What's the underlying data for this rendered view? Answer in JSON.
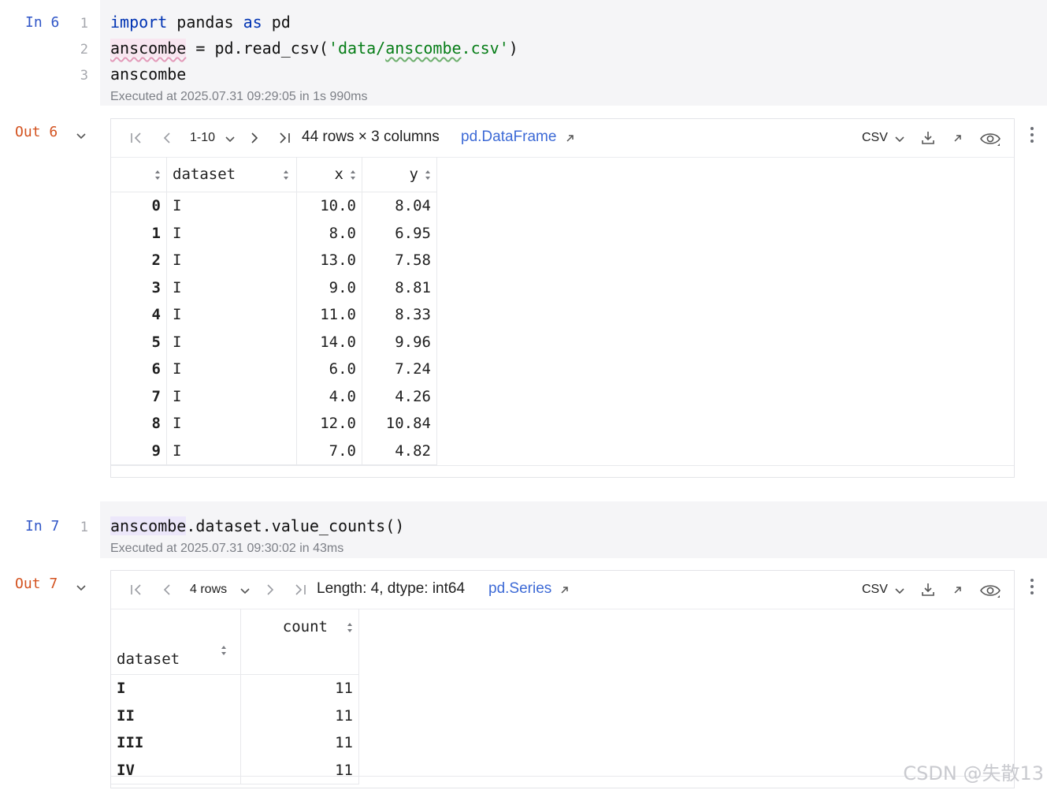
{
  "cell1": {
    "prompt_in": "In 6",
    "line_numbers": [
      "1",
      "2",
      "3"
    ],
    "code": {
      "l1_kw1": "import",
      "l1_mid": " pandas ",
      "l1_kw2": "as",
      "l1_end": " pd",
      "l2_var": "anscombe",
      "l2_mid": " = pd.read_csv(",
      "l2_str1": "'data/",
      "l2_str2": "anscombe",
      "l2_str3": ".csv'",
      "l2_end": ")",
      "l3": "anscombe"
    },
    "executed": "Executed at 2025.07.31 09:29:05 in 1s 990ms",
    "prompt_out": "Out 6",
    "toolbar": {
      "range": "1-10",
      "summary": "44 rows × 3 columns",
      "type_link": "pd.DataFrame",
      "export_label": "CSV"
    },
    "table": {
      "columns": [
        "dataset",
        "x",
        "y"
      ],
      "rows": [
        {
          "index": "0",
          "dataset": "I",
          "x": "10.0",
          "y": "8.04"
        },
        {
          "index": "1",
          "dataset": "I",
          "x": "8.0",
          "y": "6.95"
        },
        {
          "index": "2",
          "dataset": "I",
          "x": "13.0",
          "y": "7.58"
        },
        {
          "index": "3",
          "dataset": "I",
          "x": "9.0",
          "y": "8.81"
        },
        {
          "index": "4",
          "dataset": "I",
          "x": "11.0",
          "y": "8.33"
        },
        {
          "index": "5",
          "dataset": "I",
          "x": "14.0",
          "y": "9.96"
        },
        {
          "index": "6",
          "dataset": "I",
          "x": "6.0",
          "y": "7.24"
        },
        {
          "index": "7",
          "dataset": "I",
          "x": "4.0",
          "y": "4.26"
        },
        {
          "index": "8",
          "dataset": "I",
          "x": "12.0",
          "y": "10.84"
        },
        {
          "index": "9",
          "dataset": "I",
          "x": "7.0",
          "y": "4.82"
        }
      ]
    }
  },
  "cell2": {
    "prompt_in": "In 7",
    "line_numbers": [
      "1"
    ],
    "code": {
      "var": "anscombe",
      "rest": ".dataset.value_counts()"
    },
    "executed": "Executed at 2025.07.31 09:30:02 in 43ms",
    "prompt_out": "Out 7",
    "toolbar": {
      "range": "4 rows",
      "summary": "Length: 4, dtype: int64",
      "type_link": "pd.Series",
      "export_label": "CSV"
    },
    "table": {
      "index_name": "dataset",
      "value_header": "count",
      "rows": [
        {
          "index": "I",
          "count": "11"
        },
        {
          "index": "II",
          "count": "11"
        },
        {
          "index": "III",
          "count": "11"
        },
        {
          "index": "IV",
          "count": "11"
        }
      ]
    }
  },
  "watermark": "CSDN @失散13",
  "icons": [
    "first-page-icon",
    "prev-page-icon",
    "next-page-icon",
    "last-page-icon",
    "chevron-down-icon",
    "download-icon",
    "open-external-icon",
    "eye-icon",
    "sort-icon",
    "kebab-menu-icon"
  ]
}
